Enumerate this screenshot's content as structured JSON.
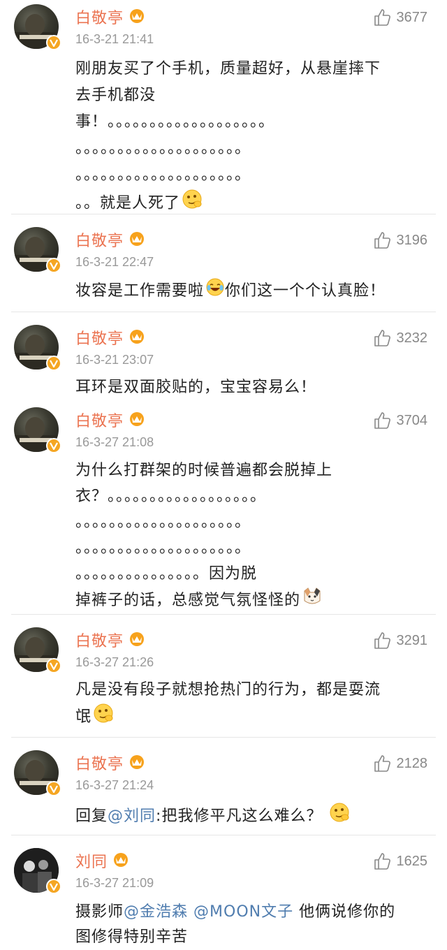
{
  "accent_color": "#eb7350",
  "mention_color": "#507daf",
  "comments": [
    {
      "user": "白敬亭",
      "time": "16-3-21 21:41",
      "likes": "3677",
      "lines": [
        "刚朋友买了个手机，质量超好，从悬崖摔下",
        "去手机都没",
        "事！。。。。。。。。。。。。。。。。。。。",
        "。。。。。。。。。。。。。。。。。。。。",
        "。。。。。。。。。。。。。。。。。。。。",
        "。。就是人死了"
      ],
      "emoji": "smirk-emoji"
    },
    {
      "user": "白敬亭",
      "time": "16-3-21 22:47",
      "likes": "3196",
      "text_before": "妆容是工作需要啦",
      "emoji": "laugh-cry-emoji",
      "text_after": "你们这一个个认真脸！"
    },
    {
      "user": "白敬亭",
      "time": "16-3-21 23:07",
      "likes": "3232",
      "lines": [
        "耳环是双面胶贴的，宝宝容易么！"
      ]
    },
    {
      "user": "白敬亭",
      "time": "16-3-27 21:08",
      "likes": "3704",
      "lines": [
        "为什么打群架的时候普遍都会脱掉上",
        "衣？。。。。。。。。。。。。。。。。。。",
        "。。。。。。。。。。。。。。。。。。。。",
        "。。。。。。。。。。。。。。。。。。。。",
        "。。。。。。。。。。。。。。。因为脱",
        "掉裤子的话，总感觉气氛怪怪的"
      ],
      "emoji": "cat-emoji"
    },
    {
      "user": "白敬亭",
      "time": "16-3-27 21:26",
      "likes": "3291",
      "lines": [
        "凡是没有段子就想抢热门的行为，都是耍流",
        "氓"
      ],
      "emoji": "smirk-emoji"
    },
    {
      "user": "白敬亭",
      "time": "16-3-27 21:24",
      "likes": "2128",
      "reply_prefix": "回复",
      "reply_mention": "@刘同",
      "reply_text": ":把我修平凡这么难么？",
      "emoji": "smirk-emoji"
    },
    {
      "user": "刘同",
      "time": "16-3-27 21:09",
      "likes": "1625",
      "prefix": "摄影师",
      "mention1": "@金浩森",
      "mention2": "@MOON文子",
      "text_mid": "他俩说修你的",
      "text_line2": "图修得特别辛苦"
    }
  ]
}
